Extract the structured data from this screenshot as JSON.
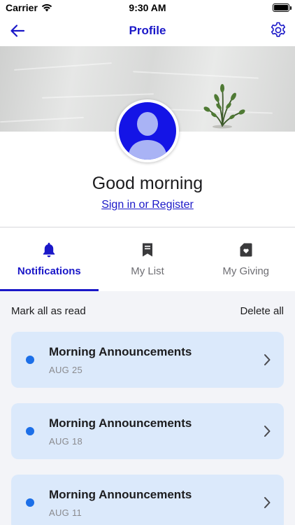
{
  "status_bar": {
    "carrier": "Carrier",
    "time": "9:30 AM"
  },
  "nav": {
    "title": "Profile",
    "back_icon": "arrow-left-icon",
    "settings_icon": "gear-icon"
  },
  "profile": {
    "greeting": "Good morning",
    "signin_link": "Sign in or Register"
  },
  "tabs": [
    {
      "label": "Notifications",
      "icon": "bell-icon",
      "active": true
    },
    {
      "label": "My List",
      "icon": "bookmark-icon",
      "active": false
    },
    {
      "label": "My Giving",
      "icon": "heart-card-icon",
      "active": false
    }
  ],
  "notifications": {
    "mark_all_label": "Mark all as read",
    "delete_all_label": "Delete all",
    "items": [
      {
        "title": "Morning Announcements",
        "date": "AUG 25",
        "unread": true
      },
      {
        "title": "Morning Announcements",
        "date": "AUG 18",
        "unread": true
      },
      {
        "title": "Morning Announcements",
        "date": "AUG 11",
        "unread": true
      }
    ]
  },
  "colors": {
    "accent": "#1a17c8",
    "avatar": "#1414e6",
    "unread_dot": "#1c6fe8",
    "card_bg": "#dbe9fb",
    "list_bg": "#f3f4f8"
  }
}
